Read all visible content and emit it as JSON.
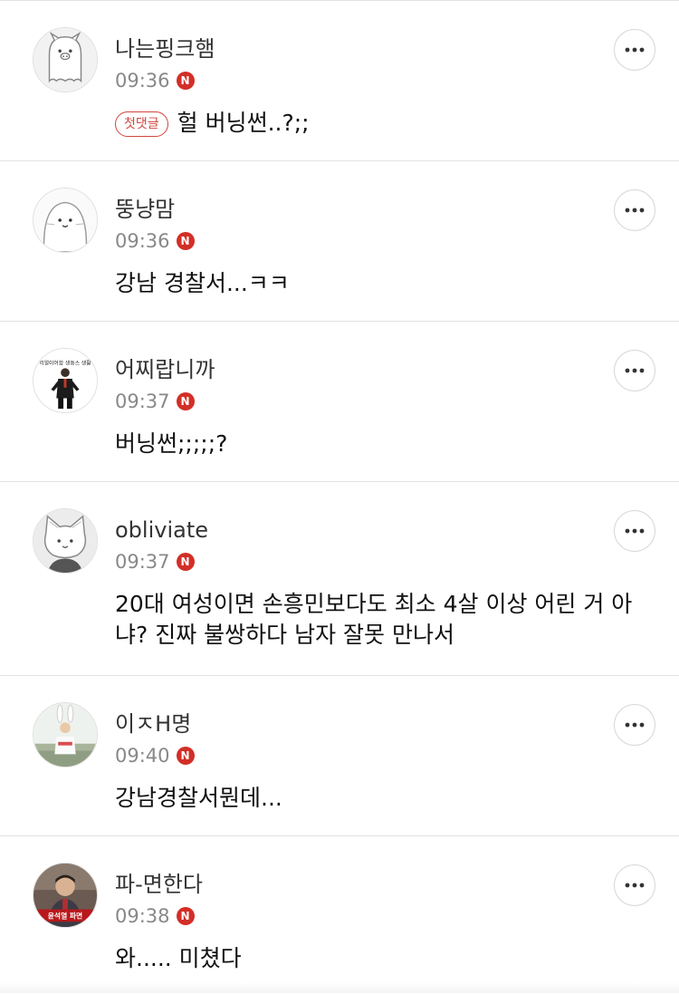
{
  "first_comment_tag": "첫댓글",
  "comments": [
    {
      "nickname": "나는핑크햄",
      "time": "09:36",
      "badge": "N",
      "text": "헐 버닝썬..?;;",
      "first": true,
      "avatar_icon": "pig-ghost-avatar"
    },
    {
      "nickname": "뚱냥맘",
      "time": "09:36",
      "badge": "N",
      "text": "강남 경찰서...ㅋㅋ",
      "avatar_icon": "round-seal-avatar"
    },
    {
      "nickname": "어찌랍니까",
      "time": "09:37",
      "badge": "N",
      "text": "버닝썬;;;;;?",
      "avatar_icon": "man-in-suit-avatar",
      "avatar_caption": "리얼이어함 생동스 생활"
    },
    {
      "nickname": "obliviate",
      "time": "09:37",
      "badge": "N",
      "text": "20대 여성이면 손흥민보다도 최소 4살 이상 어린 거 아냐? 진짜 불쌍하다 남자 잘못 만나서",
      "avatar_icon": "cat-avatar"
    },
    {
      "nickname": "이ㅈH명",
      "time": "09:40",
      "badge": "N",
      "text": "강남경찰서뭔데...",
      "avatar_icon": "bunny-ears-person-avatar"
    },
    {
      "nickname": "파-면한다",
      "time": "09:38",
      "badge": "N",
      "text": "와..... 미쳤다",
      "avatar_icon": "man-photo-avatar",
      "avatar_caption": "윤석열 파면"
    }
  ],
  "colors": {
    "badge": "#d22f27",
    "divider": "#e2e2e2",
    "time": "#888888"
  }
}
